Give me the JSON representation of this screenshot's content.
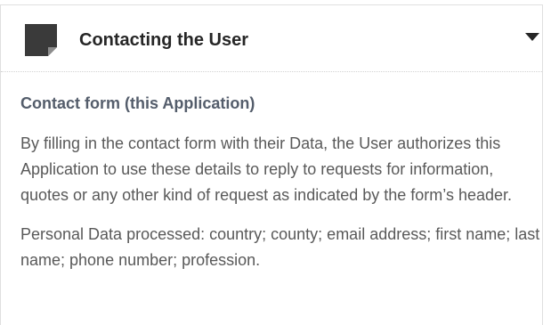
{
  "section": {
    "title": "Contacting the User",
    "icon": "document-icon",
    "toggle_icon": "triangle-down-icon"
  },
  "content": {
    "subtitle": "Contact form (this Application)",
    "description": "By filling in the contact form with their Data, the User authorizes this Application to use these details to reply to requests for information, quotes or any other kind of request as indicated by the form’s header.",
    "personal_data": "Personal Data processed: country; county; email address; first name; last name; phone number; profession."
  },
  "colors": {
    "icon": "#3a3a3a",
    "title": "#262626",
    "subtitle": "#545d6b",
    "body_text": "#595959",
    "border": "#dfdfdf"
  }
}
